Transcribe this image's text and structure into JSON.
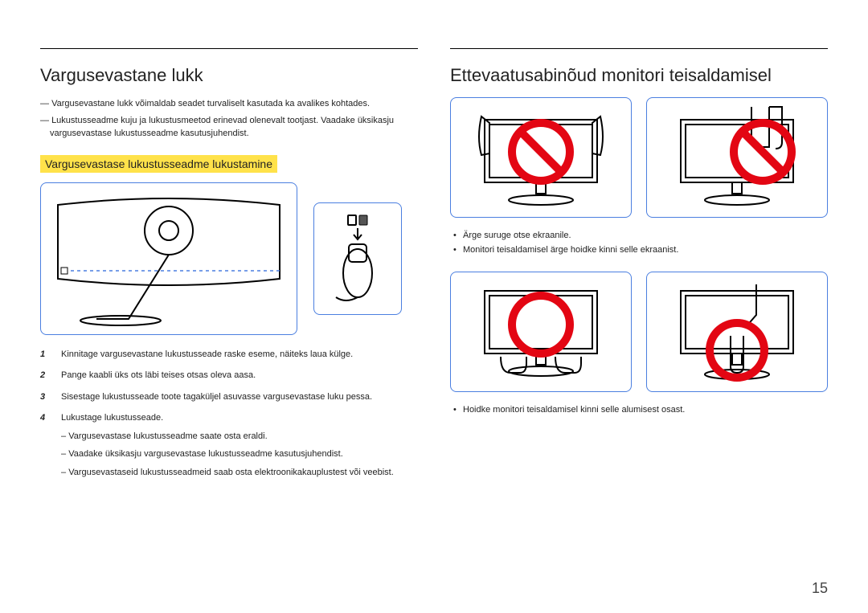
{
  "left": {
    "heading": "Vargusevastane lukk",
    "intro": [
      "Vargusevastane lukk võimaldab seadet turvaliselt kasutada ka avalikes kohtades.",
      "Lukustusseadme kuju ja lukustusmeetod erinevad olenevalt tootjast. Vaadake üksikasju vargusevastase lukustusseadme kasutusjuhendist."
    ],
    "subheading": "Vargusevastase lukustusseadme lukustamine",
    "steps": {
      "s1": "Kinnitage vargusevastane lukustusseade raske eseme, näiteks laua külge.",
      "s2": "Pange kaabli üks ots läbi teises otsas oleva aasa.",
      "s3": "Sisestage lukustusseade toote tagaküljel asuvasse vargusevastase luku pessa.",
      "s4": "Lukustage lukustusseade.",
      "s4_subs": [
        "Vargusevastase lukustusseadme saate osta eraldi.",
        "Vaadake üksikasju vargusevastase lukustusseadme kasutusjuhendist.",
        "Vargusevastaseid lukustusseadmeid saab osta elektroonikakauplustest või veebist."
      ]
    },
    "nums": {
      "n1": "1",
      "n2": "2",
      "n3": "3",
      "n4": "4"
    }
  },
  "right": {
    "heading": "Ettevaatusabinõud monitori teisaldamisel",
    "bullets_top": [
      "Ärge suruge otse ekraanile.",
      "Monitori teisaldamisel ärge hoidke kinni selle ekraanist."
    ],
    "bullets_bottom": [
      "Hoidke monitori teisaldamisel kinni selle alumisest osast."
    ]
  },
  "page": "15"
}
